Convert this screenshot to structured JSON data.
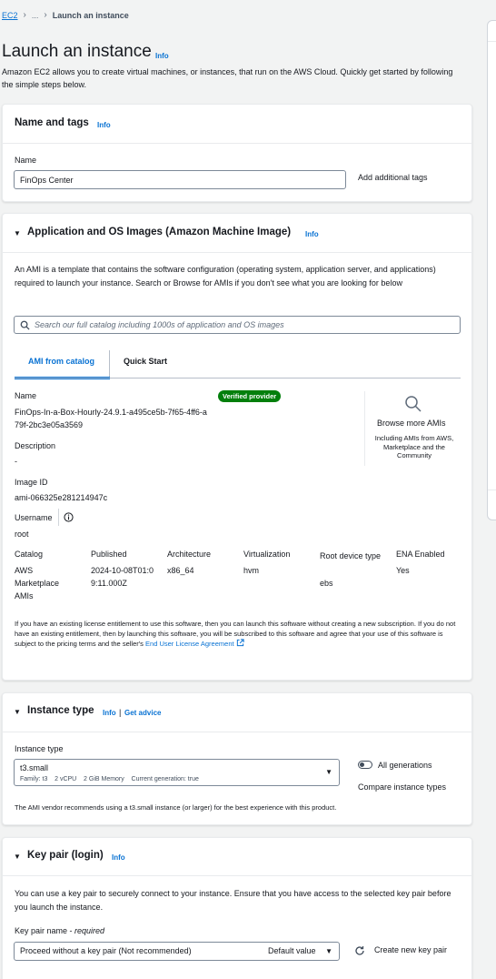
{
  "breadcrumb": {
    "root": "EC2",
    "ellipsis": "...",
    "current": "Launch an instance"
  },
  "page": {
    "title": "Launch an instance",
    "info": "Info",
    "description": "Amazon EC2 allows you to create virtual machines, or instances, that run on the AWS Cloud. Quickly get started by following the simple steps below."
  },
  "name_tags": {
    "title": "Name and tags",
    "info": "Info",
    "name_label": "Name",
    "name_value": "FinOps Center",
    "add_tags": "Add additional tags"
  },
  "ami": {
    "title": "Application and OS Images (Amazon Machine Image)",
    "info": "Info",
    "description": "An AMI is a template that contains the software configuration (operating system, application server, and applications) required to launch your instance. Search or Browse for AMIs if you don't see what you are looking for below",
    "search_placeholder": "Search our full catalog including 1000s of application and OS images",
    "tabs": [
      "AMI from catalog",
      "Quick Start"
    ],
    "name_label": "Name",
    "name_value": "FinOps-In-a-Box-Hourly-24.9.1-a495ce5b-7f65-4ff6-a79f-2bc3e05a3569",
    "verified": "Verified provider",
    "browse_more": "Browse more AMIs",
    "browse_desc": "Including AMIs from AWS, Marketplace and the Community",
    "description_label": "Description",
    "description_value": "-",
    "image_id_label": "Image ID",
    "image_id_value": "ami-066325e281214947c",
    "username_label": "Username",
    "username_value": "root",
    "details": [
      {
        "label": "Catalog",
        "value": "AWS Marketplace AMIs"
      },
      {
        "label": "Published",
        "value": "2024-10-08T01:09:11.000Z"
      },
      {
        "label": "Architecture",
        "value": "x86_64"
      },
      {
        "label": "Virtualization",
        "value": "hvm"
      },
      {
        "label": "Root device type",
        "value": "ebs"
      },
      {
        "label": "ENA Enabled",
        "value": "Yes"
      }
    ],
    "license_text": "If you have an existing license entitlement to use this software, then you can launch this software without creating a new subscription. If you do not have an existing entitlement, then by launching this software, you will be subscribed to this software and agree that your use of this software is subject to the pricing terms and the seller's",
    "license_link": "End User License Agreement"
  },
  "instance_type": {
    "title": "Instance type",
    "info": "Info",
    "separator": "|",
    "get_advice": "Get advice",
    "label": "Instance type",
    "value": "t3.small",
    "family": "Family: t3",
    "vcpu": "2 vCPU",
    "memory": "2 GiB Memory",
    "generation": "Current generation: true",
    "all_generations": "All generations",
    "compare": "Compare instance types",
    "note": "The AMI vendor recommends using a t3.small instance (or larger) for the best experience with this product."
  },
  "key_pair": {
    "title": "Key pair (login)",
    "info": "Info",
    "description": "You can use a key pair to securely connect to your instance. Ensure that you have access to the selected key pair before you launch the instance.",
    "label": "Key pair name",
    "required": "required",
    "value": "Proceed without a key pair (Not recommended)",
    "default_value": "Default value",
    "create_new": "Create new key pair"
  }
}
